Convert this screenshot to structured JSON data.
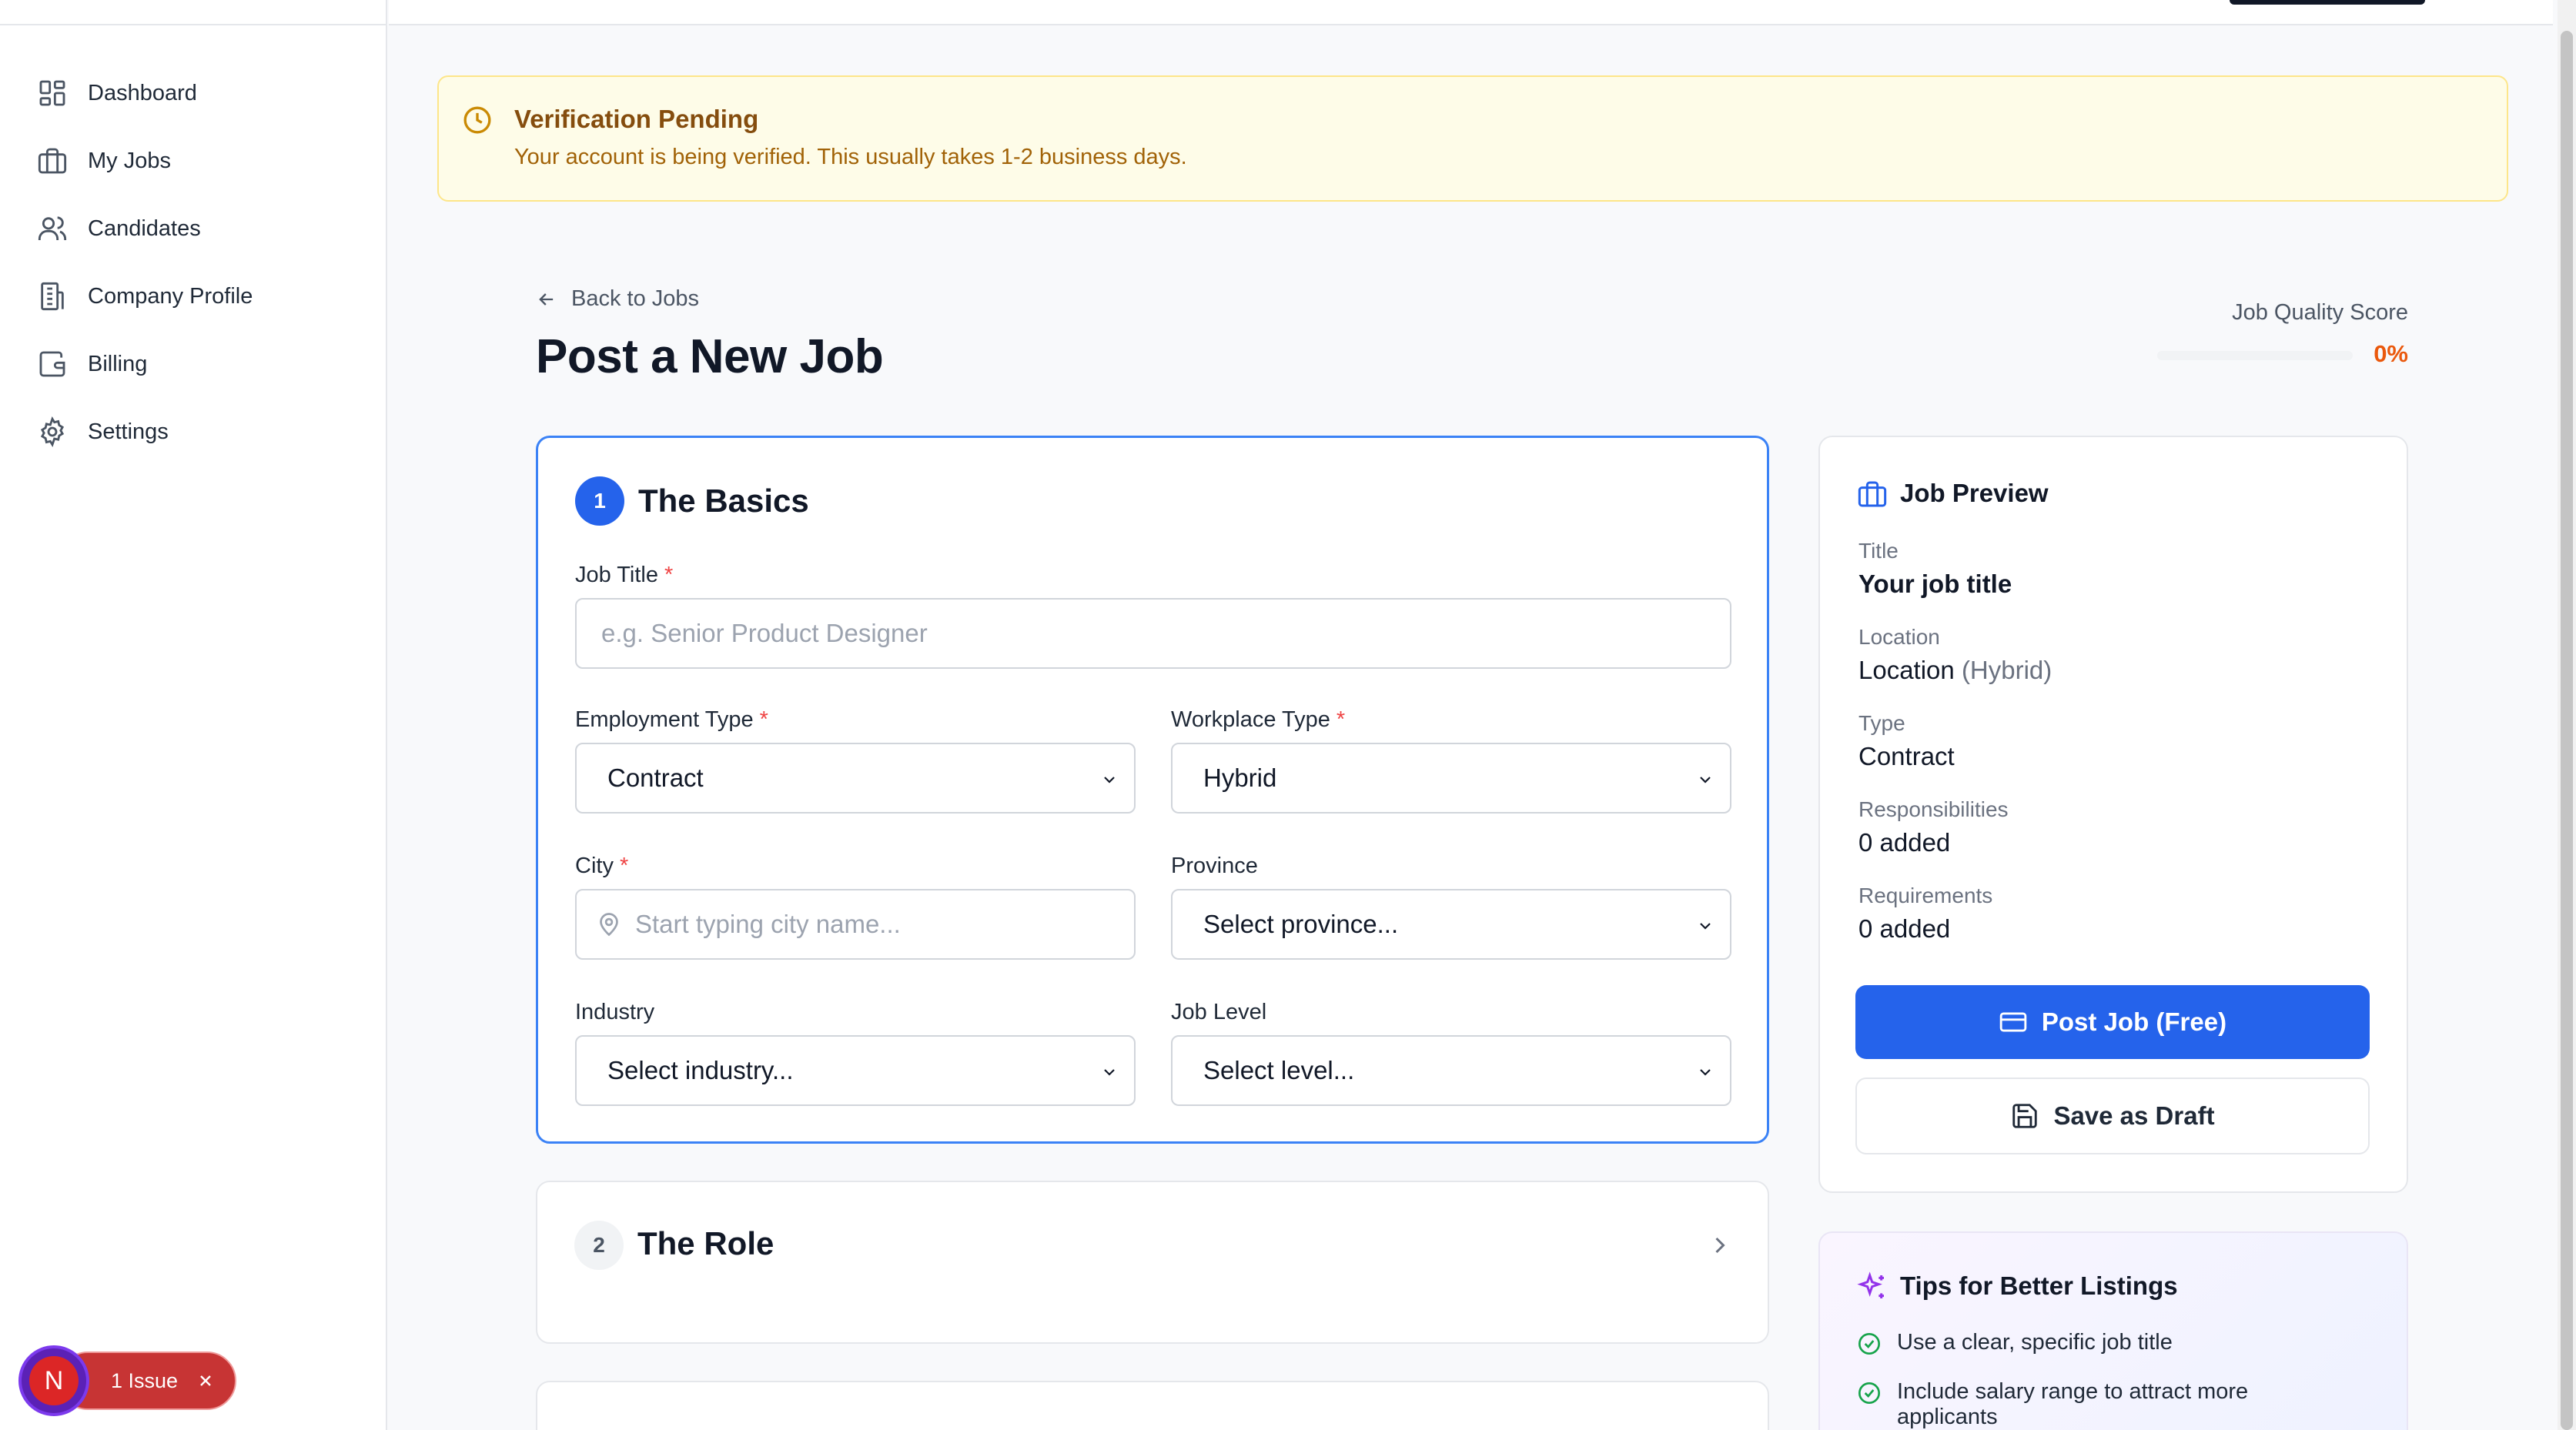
{
  "sidebar": {
    "items": [
      {
        "label": "Dashboard",
        "icon": "dashboard-icon"
      },
      {
        "label": "My Jobs",
        "icon": "briefcase-icon"
      },
      {
        "label": "Candidates",
        "icon": "users-icon"
      },
      {
        "label": "Company Profile",
        "icon": "building-icon"
      },
      {
        "label": "Billing",
        "icon": "wallet-icon"
      },
      {
        "label": "Settings",
        "icon": "gear-icon"
      }
    ]
  },
  "banner": {
    "title": "Verification Pending",
    "message": "Your account is being verified. This usually takes 1-2 business days."
  },
  "header": {
    "back_label": "Back to Jobs",
    "title": "Post a New Job",
    "quality_label": "Job Quality Score",
    "quality_value": "0%",
    "quality_fraction": 0
  },
  "basics": {
    "step": "1",
    "title": "The Basics",
    "job_title_label": "Job Title",
    "job_title_placeholder": "e.g. Senior Product Designer",
    "employment_type_label": "Employment Type",
    "employment_type_value": "Contract",
    "workplace_type_label": "Workplace Type",
    "workplace_type_value": "Hybrid",
    "city_label": "City",
    "city_placeholder": "Start typing city name...",
    "province_label": "Province",
    "province_value": "Select province...",
    "industry_label": "Industry",
    "industry_value": "Select industry...",
    "job_level_label": "Job Level",
    "job_level_value": "Select level...",
    "required_mark": "*"
  },
  "role": {
    "step": "2",
    "title": "The Role"
  },
  "preview": {
    "title": "Job Preview",
    "title_label": "Title",
    "title_value": "Your job title",
    "location_label": "Location",
    "location_value": "Location",
    "location_suffix": "(Hybrid)",
    "type_label": "Type",
    "type_value": "Contract",
    "responsibilities_label": "Responsibilities",
    "responsibilities_value": "0 added",
    "requirements_label": "Requirements",
    "requirements_value": "0 added",
    "post_button": "Post Job (Free)",
    "draft_button": "Save as Draft"
  },
  "tips": {
    "title": "Tips for Better Listings",
    "items": [
      "Use a clear, specific job title",
      "Include salary range to attract more applicants"
    ]
  },
  "issue_badge": {
    "avatar_letter": "N",
    "label": "1 Issue"
  },
  "colors": {
    "accent": "#2563eb",
    "warning_bg": "#fefce8",
    "score": "#ea580c"
  }
}
